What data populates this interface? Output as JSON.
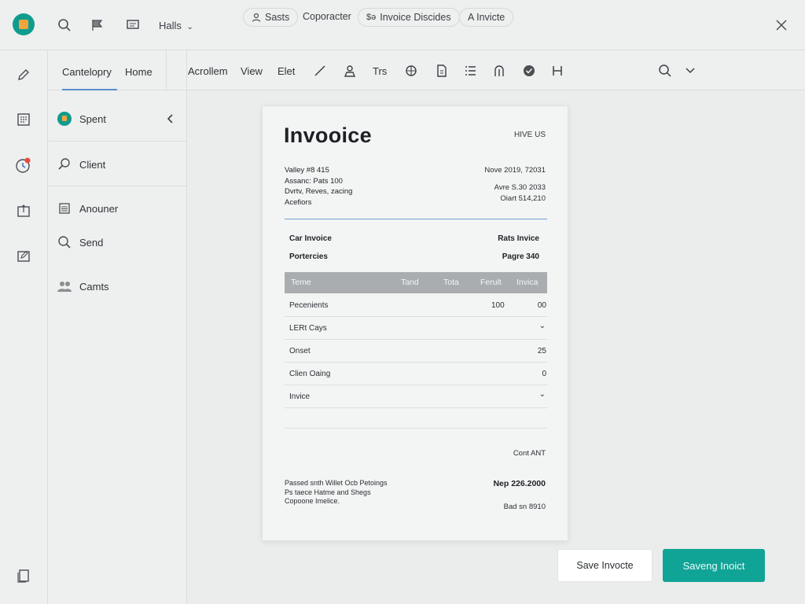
{
  "colors": {
    "accent": "#10a497",
    "rule": "#6aa0d8",
    "table_header": "#a9adb0",
    "badge": "#e74c3c"
  },
  "topbar": {
    "menu_label": "Halls",
    "pills": [
      {
        "icon": "person-icon",
        "label": "Sasts"
      },
      {
        "icon": "",
        "label": "Coporacter"
      },
      {
        "icon": "money-icon",
        "label": "Invoice Discides"
      },
      {
        "icon": "",
        "label": "A Invicte"
      }
    ]
  },
  "panel": {
    "tabs": [
      "Cantelopry",
      "Home"
    ],
    "items": [
      {
        "icon": "spent-avatar-icon",
        "label": "Spent"
      },
      {
        "icon": "search-icon",
        "label": "Client"
      },
      {
        "icon": "document-icon",
        "label": "Anouner"
      },
      {
        "icon": "search-icon",
        "label": "Send"
      },
      {
        "icon": "people-icon",
        "label": "Camts"
      }
    ]
  },
  "toolbar": {
    "items": [
      "Acrollem",
      "View",
      "Elet",
      "Trs"
    ]
  },
  "invoice": {
    "title": "Invooice",
    "tag": "HIVE US",
    "address": [
      "Valley #8 415",
      "Assanc: Pats 100",
      "Dvrtv, Reves, zacing",
      "Acefiors"
    ],
    "meta": [
      "Nove 2019, 72031",
      "Avre S.30 2033",
      "Oiart 514,210"
    ],
    "row_a_left": "Car Invoice",
    "row_a_right": "Rats Invice",
    "row_b_left": "Portercies",
    "row_b_right": "Pagre 340",
    "table": {
      "headers": [
        "Teme",
        "Tand",
        "Tota",
        "Ferult",
        "Invica"
      ],
      "rows": [
        {
          "name": "Pecenients",
          "c3": "100",
          "c4": "00"
        },
        {
          "name": "LERt Cays",
          "c3": "",
          "c4": "⌄"
        },
        {
          "name": "Onset",
          "c3": "",
          "c4": "25"
        },
        {
          "name": "Clien Oaing",
          "c3": "",
          "c4": "0"
        },
        {
          "name": "Invice",
          "c3": "",
          "c4": "⌄"
        }
      ]
    },
    "cont_label": "Cont ANT",
    "footer_lines": [
      "Passed snth Willet Ocb Petoings",
      "Ps taece Hatme and Shegs",
      "Copoone Imelice."
    ],
    "footer_date": "Nep 226.2000",
    "footer_amount": "Bad sn 8910"
  },
  "actions": {
    "save_label": "Save Invocte",
    "primary_label": "Saveng Inoict"
  }
}
